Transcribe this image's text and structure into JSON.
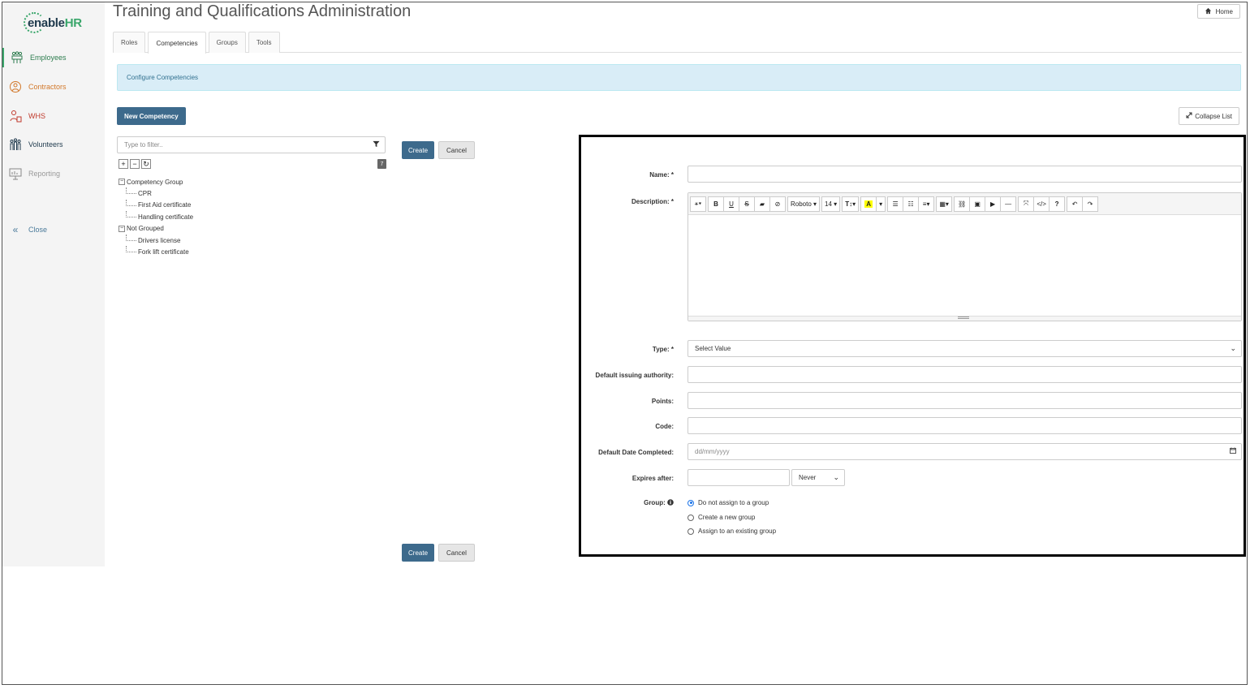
{
  "brand": {
    "logo_prefix": "enable",
    "logo_suffix": "HR"
  },
  "sidebar": {
    "items": [
      {
        "label": "Employees",
        "icon": "employees-icon",
        "color": "#2e7d4f"
      },
      {
        "label": "Contractors",
        "icon": "contractors-icon",
        "color": "#d2782a"
      },
      {
        "label": "WHS",
        "icon": "whs-icon",
        "color": "#c0392b"
      },
      {
        "label": "Volunteers",
        "icon": "volunteers-icon",
        "color": "#1f3a4d"
      },
      {
        "label": "Reporting",
        "icon": "reporting-icon",
        "color": "#999999"
      }
    ],
    "close_label": "Close"
  },
  "header": {
    "title": "Training and Qualifications Administration",
    "home_label": "Home"
  },
  "tabs": [
    {
      "label": "Roles",
      "active": false
    },
    {
      "label": "Competencies",
      "active": true
    },
    {
      "label": "Groups",
      "active": false
    },
    {
      "label": "Tools",
      "active": false
    }
  ],
  "info_bar": {
    "text": "Configure Competencies"
  },
  "actions": {
    "new_competency": "New Competency",
    "collapse_list": "Collapse List"
  },
  "tree": {
    "filter_placeholder": "Type to filter..",
    "count": "7",
    "groups": [
      {
        "name": "Competency Group",
        "items": [
          "CPR",
          "First Aid certificate",
          "Handling certificate"
        ]
      },
      {
        "name": "Not Grouped",
        "items": [
          "Drivers license",
          "Fork lift certificate"
        ]
      }
    ]
  },
  "buttons": {
    "create": "Create",
    "cancel": "Cancel"
  },
  "form": {
    "name_label": "Name: *",
    "description_label": "Description: *",
    "editor": {
      "font_name": "Roboto",
      "font_size": "14"
    },
    "type_label": "Type: *",
    "type_value": "Select Value",
    "authority_label": "Default issuing authority:",
    "points_label": "Points:",
    "code_label": "Code:",
    "date_label": "Default Date Completed:",
    "date_placeholder": "dd/mm/yyyy",
    "expires_label": "Expires after:",
    "expires_unit": "Never",
    "group_label": "Group:",
    "group_options": [
      {
        "label": "Do not assign to a group",
        "selected": true
      },
      {
        "label": "Create a new group",
        "selected": false
      },
      {
        "label": "Assign to an existing group",
        "selected": false
      }
    ]
  },
  "colors": {
    "brand_green": "#3aa66b",
    "primary_button": "#3d6a8c",
    "info_bg": "#d9edf7"
  }
}
